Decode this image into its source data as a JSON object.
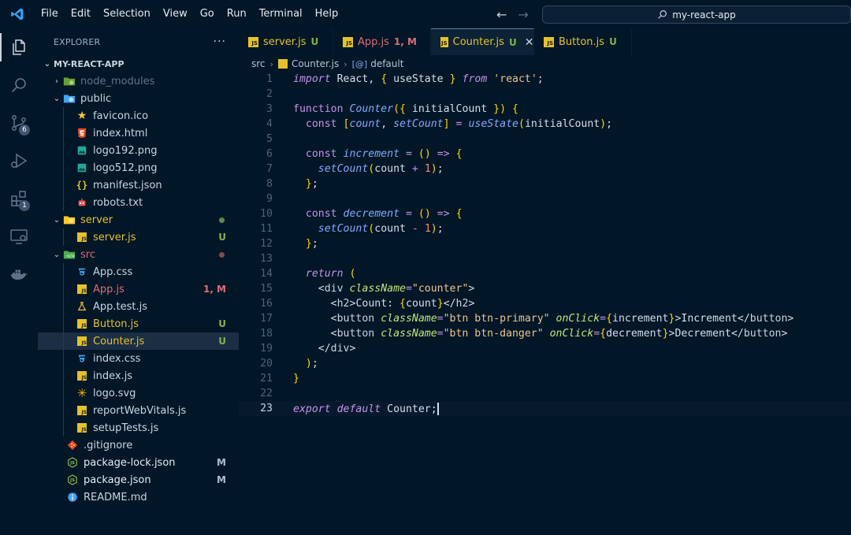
{
  "titlebar": {
    "menu": [
      "File",
      "Edit",
      "Selection",
      "View",
      "Go",
      "Run",
      "Terminal",
      "Help"
    ],
    "search": "my-react-app"
  },
  "activity": {
    "scm_badge": "6",
    "extensions_badge": "1"
  },
  "explorer": {
    "title": "EXPLORER",
    "more": "···",
    "root": "MY-REACT-APP",
    "items": [
      {
        "label": "node_modules",
        "depth": 1,
        "type": "folder",
        "chev": "›",
        "icon": "node",
        "dim": true
      },
      {
        "label": "public",
        "depth": 1,
        "type": "folder",
        "chev": "⌄",
        "icon": "public"
      },
      {
        "label": "favicon.ico",
        "depth": 2,
        "icon": "star"
      },
      {
        "label": "index.html",
        "depth": 2,
        "icon": "html"
      },
      {
        "label": "logo192.png",
        "depth": 2,
        "icon": "image"
      },
      {
        "label": "logo512.png",
        "depth": 2,
        "icon": "image"
      },
      {
        "label": "manifest.json",
        "depth": 2,
        "icon": "json-braces"
      },
      {
        "label": "robots.txt",
        "depth": 2,
        "icon": "robot"
      },
      {
        "label": "server",
        "depth": 1,
        "type": "folder",
        "chev": "⌄",
        "icon": "folder-yellow",
        "color": "#e5c22b",
        "dot": "#5c8b4c"
      },
      {
        "label": "server.js",
        "depth": 2,
        "icon": "js",
        "color": "#e5c22b",
        "status": "U",
        "status_color": "#7fb34a"
      },
      {
        "label": "src",
        "depth": 1,
        "type": "folder",
        "chev": "⌄",
        "icon": "folder-src",
        "color": "#e06c75",
        "dot": "#8b4a4a"
      },
      {
        "label": "App.css",
        "depth": 2,
        "icon": "css"
      },
      {
        "label": "App.js",
        "depth": 2,
        "icon": "js",
        "color": "#e06c75",
        "status": "1, M",
        "status_color": "#e06c75"
      },
      {
        "label": "App.test.js",
        "depth": 2,
        "icon": "flask"
      },
      {
        "label": "Button.js",
        "depth": 2,
        "icon": "js",
        "color": "#e5c22b",
        "status": "U",
        "status_color": "#7fb34a"
      },
      {
        "label": "Counter.js",
        "depth": 2,
        "icon": "js",
        "color": "#e5c22b",
        "status": "U",
        "status_color": "#7fb34a",
        "selected": true
      },
      {
        "label": "index.css",
        "depth": 2,
        "icon": "css"
      },
      {
        "label": "index.js",
        "depth": 2,
        "icon": "js"
      },
      {
        "label": "logo.svg",
        "depth": 2,
        "icon": "svg"
      },
      {
        "label": "reportWebVitals.js",
        "depth": 2,
        "icon": "js"
      },
      {
        "label": "setupTests.js",
        "depth": 2,
        "icon": "js"
      },
      {
        "label": ".gitignore",
        "depth": 1,
        "icon": "git"
      },
      {
        "label": "package-lock.json",
        "depth": 1,
        "icon": "node-json",
        "color": "#e6edf3",
        "status": "M",
        "status_color": "#a9bdd0"
      },
      {
        "label": "package.json",
        "depth": 1,
        "icon": "node-json",
        "color": "#e6edf3",
        "status": "M",
        "status_color": "#a9bdd0"
      },
      {
        "label": "README.md",
        "depth": 1,
        "icon": "info"
      }
    ]
  },
  "tabs": [
    {
      "label": "server.js",
      "status": "U",
      "status_color": "#7fb34a",
      "color": "#e5c22b",
      "width": 120
    },
    {
      "label": "App.js",
      "status": "1, M",
      "status_color": "#e06c75",
      "color": "#e06c75",
      "width": 124
    },
    {
      "label": "Counter.js",
      "status": "U",
      "status_color": "#7fb34a",
      "color": "#e5c22b",
      "width": 131,
      "active": true,
      "close": "✕"
    },
    {
      "label": "Button.js",
      "status": "U",
      "status_color": "#7fb34a",
      "color": "#e5c22b",
      "width": 124
    }
  ],
  "breadcrumb": {
    "folder": "src",
    "file": "Counter.js",
    "symbol_icon": "[@]",
    "symbol": "default"
  },
  "editor": {
    "current_line": 23,
    "lines": [
      "import React, { useState } from 'react';",
      "",
      "function Counter({ initialCount }) {",
      "  const [count, setCount] = useState(initialCount);",
      "",
      "  const increment = () => {",
      "    setCount(count + 1);",
      "  };",
      "",
      "  const decrement = () => {",
      "    setCount(count - 1);",
      "  };",
      "",
      "  return (",
      "    <div className=\"counter\">",
      "      <h2>Count: {count}</h2>",
      "      <button className=\"btn btn-primary\" onClick={increment}>Increment</button>",
      "      <button className=\"btn btn-danger\" onClick={decrement}>Decrement</button>",
      "    </div>",
      "  );",
      "}",
      "",
      "export default Counter;"
    ]
  }
}
